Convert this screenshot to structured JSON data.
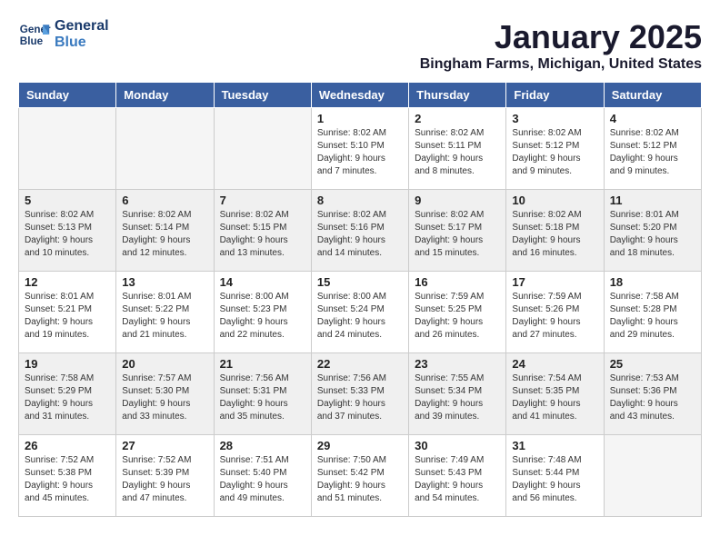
{
  "logo": {
    "text_line1": "General",
    "text_line2": "Blue"
  },
  "title": "January 2025",
  "location": "Bingham Farms, Michigan, United States",
  "days_of_week": [
    "Sunday",
    "Monday",
    "Tuesday",
    "Wednesday",
    "Thursday",
    "Friday",
    "Saturday"
  ],
  "weeks": [
    [
      {
        "day": "",
        "info": ""
      },
      {
        "day": "",
        "info": ""
      },
      {
        "day": "",
        "info": ""
      },
      {
        "day": "1",
        "info": "Sunrise: 8:02 AM\nSunset: 5:10 PM\nDaylight: 9 hours\nand 7 minutes."
      },
      {
        "day": "2",
        "info": "Sunrise: 8:02 AM\nSunset: 5:11 PM\nDaylight: 9 hours\nand 8 minutes."
      },
      {
        "day": "3",
        "info": "Sunrise: 8:02 AM\nSunset: 5:12 PM\nDaylight: 9 hours\nand 9 minutes."
      },
      {
        "day": "4",
        "info": "Sunrise: 8:02 AM\nSunset: 5:12 PM\nDaylight: 9 hours\nand 9 minutes."
      }
    ],
    [
      {
        "day": "5",
        "info": "Sunrise: 8:02 AM\nSunset: 5:13 PM\nDaylight: 9 hours\nand 10 minutes."
      },
      {
        "day": "6",
        "info": "Sunrise: 8:02 AM\nSunset: 5:14 PM\nDaylight: 9 hours\nand 12 minutes."
      },
      {
        "day": "7",
        "info": "Sunrise: 8:02 AM\nSunset: 5:15 PM\nDaylight: 9 hours\nand 13 minutes."
      },
      {
        "day": "8",
        "info": "Sunrise: 8:02 AM\nSunset: 5:16 PM\nDaylight: 9 hours\nand 14 minutes."
      },
      {
        "day": "9",
        "info": "Sunrise: 8:02 AM\nSunset: 5:17 PM\nDaylight: 9 hours\nand 15 minutes."
      },
      {
        "day": "10",
        "info": "Sunrise: 8:02 AM\nSunset: 5:18 PM\nDaylight: 9 hours\nand 16 minutes."
      },
      {
        "day": "11",
        "info": "Sunrise: 8:01 AM\nSunset: 5:20 PM\nDaylight: 9 hours\nand 18 minutes."
      }
    ],
    [
      {
        "day": "12",
        "info": "Sunrise: 8:01 AM\nSunset: 5:21 PM\nDaylight: 9 hours\nand 19 minutes."
      },
      {
        "day": "13",
        "info": "Sunrise: 8:01 AM\nSunset: 5:22 PM\nDaylight: 9 hours\nand 21 minutes."
      },
      {
        "day": "14",
        "info": "Sunrise: 8:00 AM\nSunset: 5:23 PM\nDaylight: 9 hours\nand 22 minutes."
      },
      {
        "day": "15",
        "info": "Sunrise: 8:00 AM\nSunset: 5:24 PM\nDaylight: 9 hours\nand 24 minutes."
      },
      {
        "day": "16",
        "info": "Sunrise: 7:59 AM\nSunset: 5:25 PM\nDaylight: 9 hours\nand 26 minutes."
      },
      {
        "day": "17",
        "info": "Sunrise: 7:59 AM\nSunset: 5:26 PM\nDaylight: 9 hours\nand 27 minutes."
      },
      {
        "day": "18",
        "info": "Sunrise: 7:58 AM\nSunset: 5:28 PM\nDaylight: 9 hours\nand 29 minutes."
      }
    ],
    [
      {
        "day": "19",
        "info": "Sunrise: 7:58 AM\nSunset: 5:29 PM\nDaylight: 9 hours\nand 31 minutes."
      },
      {
        "day": "20",
        "info": "Sunrise: 7:57 AM\nSunset: 5:30 PM\nDaylight: 9 hours\nand 33 minutes."
      },
      {
        "day": "21",
        "info": "Sunrise: 7:56 AM\nSunset: 5:31 PM\nDaylight: 9 hours\nand 35 minutes."
      },
      {
        "day": "22",
        "info": "Sunrise: 7:56 AM\nSunset: 5:33 PM\nDaylight: 9 hours\nand 37 minutes."
      },
      {
        "day": "23",
        "info": "Sunrise: 7:55 AM\nSunset: 5:34 PM\nDaylight: 9 hours\nand 39 minutes."
      },
      {
        "day": "24",
        "info": "Sunrise: 7:54 AM\nSunset: 5:35 PM\nDaylight: 9 hours\nand 41 minutes."
      },
      {
        "day": "25",
        "info": "Sunrise: 7:53 AM\nSunset: 5:36 PM\nDaylight: 9 hours\nand 43 minutes."
      }
    ],
    [
      {
        "day": "26",
        "info": "Sunrise: 7:52 AM\nSunset: 5:38 PM\nDaylight: 9 hours\nand 45 minutes."
      },
      {
        "day": "27",
        "info": "Sunrise: 7:52 AM\nSunset: 5:39 PM\nDaylight: 9 hours\nand 47 minutes."
      },
      {
        "day": "28",
        "info": "Sunrise: 7:51 AM\nSunset: 5:40 PM\nDaylight: 9 hours\nand 49 minutes."
      },
      {
        "day": "29",
        "info": "Sunrise: 7:50 AM\nSunset: 5:42 PM\nDaylight: 9 hours\nand 51 minutes."
      },
      {
        "day": "30",
        "info": "Sunrise: 7:49 AM\nSunset: 5:43 PM\nDaylight: 9 hours\nand 54 minutes."
      },
      {
        "day": "31",
        "info": "Sunrise: 7:48 AM\nSunset: 5:44 PM\nDaylight: 9 hours\nand 56 minutes."
      },
      {
        "day": "",
        "info": ""
      }
    ]
  ]
}
